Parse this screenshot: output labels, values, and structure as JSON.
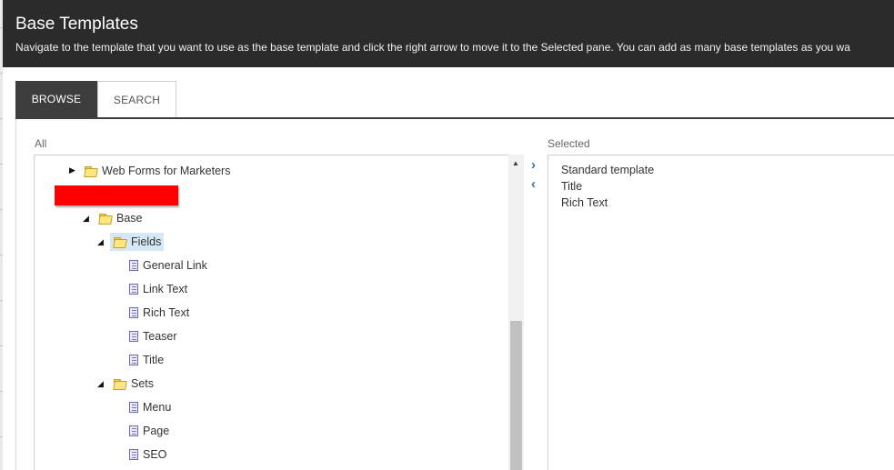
{
  "dialog": {
    "title": "Base Templates",
    "description": "Navigate to the template that you want to use as the base template and click the right arrow to move it to the Selected pane. You can add as many base templates as you wa"
  },
  "tabs": [
    {
      "label": "BROWSE",
      "active": true
    },
    {
      "label": "SEARCH",
      "active": false
    }
  ],
  "left_pane": {
    "label": "All",
    "tree": [
      {
        "label": "Web Forms for Marketers",
        "type": "folder",
        "state": "collapsed"
      },
      {
        "label": "Base",
        "type": "folder",
        "state": "expanded"
      },
      {
        "label": "Fields",
        "type": "folder",
        "state": "expanded",
        "selected": true
      },
      {
        "label": "General Link",
        "type": "field"
      },
      {
        "label": "Link Text",
        "type": "field"
      },
      {
        "label": "Rich Text",
        "type": "field"
      },
      {
        "label": "Teaser",
        "type": "field"
      },
      {
        "label": "Title",
        "type": "field"
      },
      {
        "label": "Sets",
        "type": "folder",
        "state": "expanded"
      },
      {
        "label": "Menu",
        "type": "field"
      },
      {
        "label": "Page",
        "type": "field"
      },
      {
        "label": "SEO",
        "type": "field"
      }
    ]
  },
  "move_buttons": {
    "right": "›",
    "left": "‹"
  },
  "right_pane": {
    "label": "Selected",
    "items": [
      "Standard template",
      "Title",
      "Rich Text"
    ]
  },
  "colors": {
    "header_bg": "#2b2b2b",
    "tab_active_bg": "#3d3d3d",
    "selected_node_bg": "#d4e8f6",
    "arrow_color": "#3a6fae",
    "redaction": "#ff0000"
  }
}
